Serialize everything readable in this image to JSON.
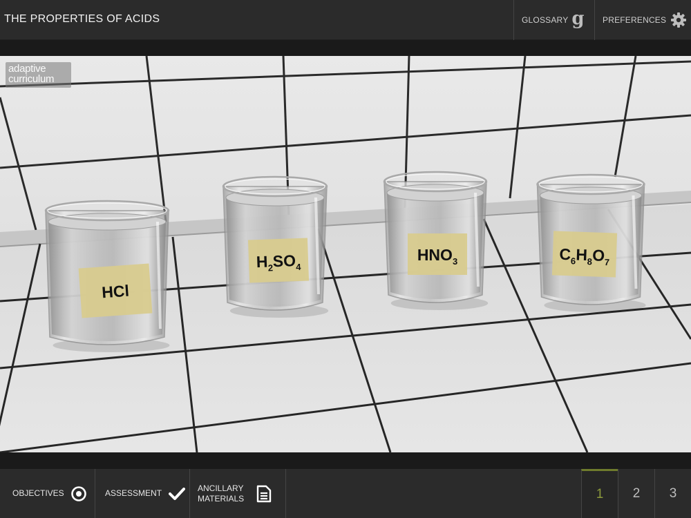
{
  "header": {
    "title": "THE PROPERTIES OF ACIDS",
    "glossary_label": "GLOSSARY",
    "preferences_label": "PREFERENCES"
  },
  "logo": {
    "line1": "adaptive",
    "line2": "curriculum"
  },
  "beakers": [
    {
      "label": "HCl",
      "formula": [
        "HCl"
      ]
    },
    {
      "label": "H2SO4",
      "formula": [
        "H",
        "2",
        "SO",
        "4"
      ]
    },
    {
      "label": "HNO3",
      "formula": [
        "HNO",
        "3"
      ]
    },
    {
      "label": "C6H8O7",
      "formula": [
        "C",
        "6",
        "H",
        "8",
        "O",
        "7"
      ]
    }
  ],
  "footer": {
    "objectives_label": "OBJECTIVES",
    "assessment_label": "ASSESSMENT",
    "ancillary_line1": "ANCILLARY",
    "ancillary_line2": "MATERIALS",
    "pages": [
      "1",
      "2",
      "3"
    ],
    "current_page": "1"
  },
  "colors": {
    "bar": "#2b2b2b",
    "accent_page": "#8c9a3c",
    "label_paper": "#d8cb8e"
  }
}
